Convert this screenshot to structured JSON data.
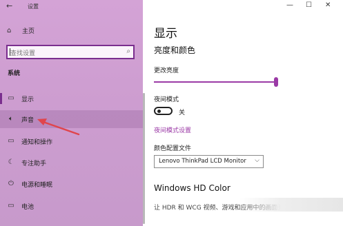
{
  "titlebar": {
    "title": "设置",
    "back_icon": "back-arrow-icon"
  },
  "window_controls": {
    "minimize": "—",
    "maximize": "☐",
    "close": "✕"
  },
  "sidebar": {
    "home": {
      "icon": "home-icon",
      "label": "主页"
    },
    "search": {
      "placeholder": "查找设置",
      "icon": "search-icon"
    },
    "section": "系统",
    "items": [
      {
        "icon": "display-icon",
        "label": "显示",
        "selected": true
      },
      {
        "icon": "speaker-icon",
        "label": "声音",
        "hover": true
      },
      {
        "icon": "notification-icon",
        "label": "通知和操作"
      },
      {
        "icon": "moon-icon",
        "label": "专注助手"
      },
      {
        "icon": "power-icon",
        "label": "电源和睡眠"
      },
      {
        "icon": "battery-icon",
        "label": "电池"
      }
    ]
  },
  "content": {
    "title": "显示",
    "brightness_heading": "亮度和颜色",
    "brightness_label": "更改亮度",
    "brightness_value": 1.0,
    "night_mode_label": "夜间模式",
    "night_mode_state": "关",
    "night_mode_link": "夜间模式设置",
    "color_profile_label": "颜色配置文件",
    "color_profile_value": "Lenovo ThinkPad LCD Monitor",
    "hd_heading": "Windows HD Color",
    "hd_description": "让 HDR 和 WCG 视频、游戏和应用中的画面更明亮、更生动。"
  },
  "colors": {
    "accent": "#9b3aa6",
    "sidebar_bg": "#cd9dd0",
    "annotation_arrow": "#e0454c"
  }
}
